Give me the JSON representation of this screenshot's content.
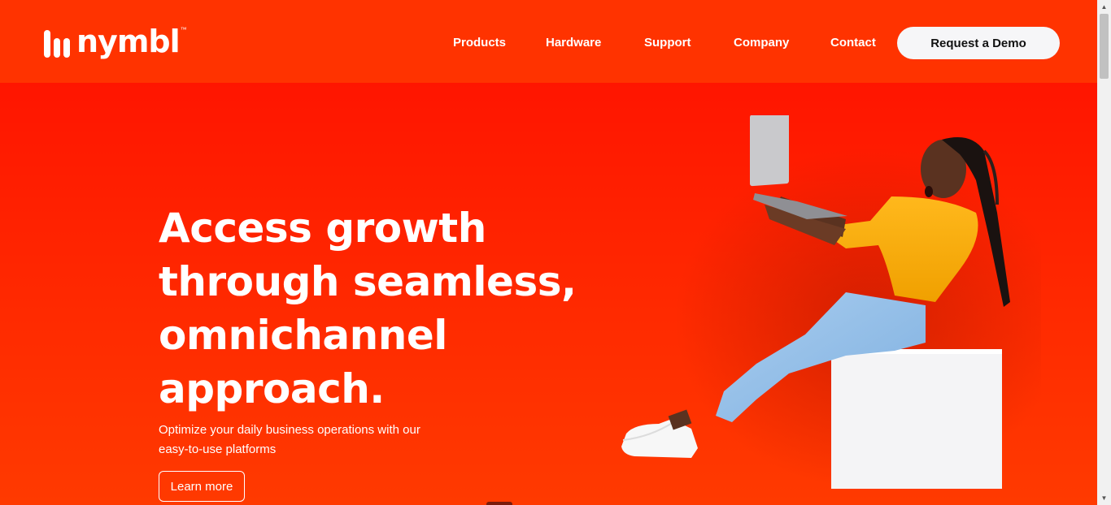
{
  "brand": {
    "name": "nymbl",
    "trademark": "™"
  },
  "nav": {
    "items": [
      {
        "label": "Products"
      },
      {
        "label": "Hardware"
      },
      {
        "label": "Support"
      },
      {
        "label": "Company"
      },
      {
        "label": "Contact"
      }
    ],
    "cta_label": "Request a Demo"
  },
  "hero": {
    "headline_lines": [
      "Access growth",
      "through seamless,",
      "omnichannel",
      "approach."
    ],
    "subtext_lines": [
      "Optimize your daily business operations with our",
      "easy-to-use platforms"
    ],
    "button_label": "Learn more"
  },
  "colors": {
    "accent": "#ff3300",
    "hero_bg": "#ff2a00",
    "button_bg": "#f6f6f8"
  },
  "icons": [
    "nymbl-logo-icon",
    "scroll-up-arrow-icon",
    "scroll-down-arrow-icon"
  ]
}
